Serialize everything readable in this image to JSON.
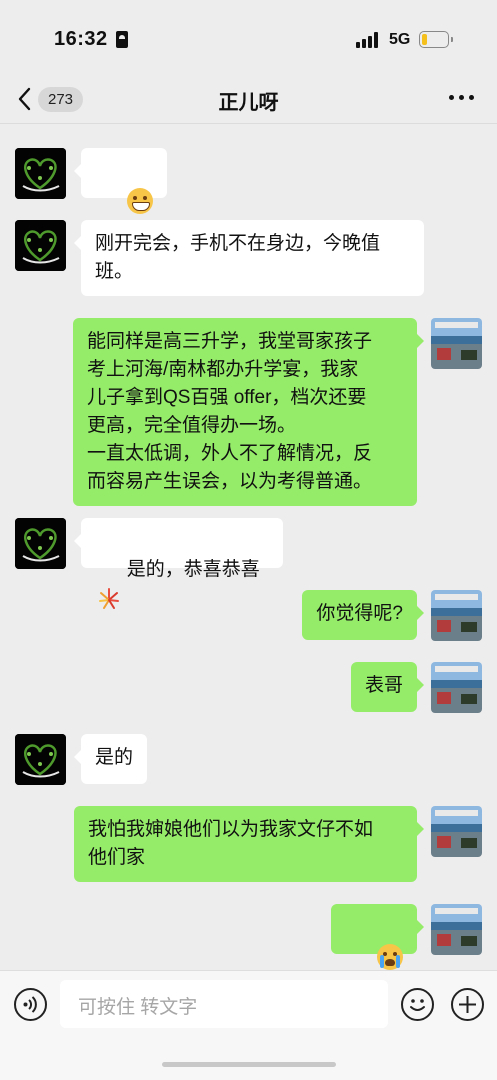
{
  "status_bar": {
    "time": "16:32",
    "network": "5G",
    "battery_level_fraction": 0.2,
    "battery_color": "#f5c01b"
  },
  "nav": {
    "unread_count": "273",
    "title": "正儿呀",
    "back_icon": "chevron-left-icon",
    "more_icon": "more-dots-icon"
  },
  "messages": [
    {
      "side": "left",
      "kind": "emoji",
      "text": "",
      "emoji": "grinning-face"
    },
    {
      "side": "left",
      "kind": "text",
      "text": "刚开完会，手机不在身边，今晚值\n班。"
    },
    {
      "side": "right",
      "kind": "text",
      "text": "能同样是高三升学，我堂哥家孩子\n考上河海/南林都办升学宴，我家\n儿子拿到QS百强 offer，档次还要\n更高，完全值得办一场。\n一直太低调，外人不了解情况，反\n而容易产生误会，以为考得普通。"
    },
    {
      "side": "left",
      "kind": "text",
      "text": "是的，恭喜恭喜",
      "emoji": "firework"
    },
    {
      "side": "right",
      "kind": "text",
      "text": "你觉得呢?"
    },
    {
      "side": "right",
      "kind": "text",
      "text": "表哥"
    },
    {
      "side": "left",
      "kind": "text",
      "text": "是的"
    },
    {
      "side": "right",
      "kind": "text",
      "text": "我怕我婶娘他们以为我家文仔不如\n他们家"
    },
    {
      "side": "right",
      "kind": "emoji",
      "text": "",
      "emoji": "crying-face"
    }
  ],
  "input": {
    "placeholder": "可按住 转文字",
    "voice_icon": "voice-icon",
    "emoji_icon": "emoji-icon",
    "plus_icon": "plus-icon"
  },
  "colors": {
    "background": "#ededed",
    "outgoing_bubble": "#95ec69",
    "incoming_bubble": "#ffffff"
  }
}
